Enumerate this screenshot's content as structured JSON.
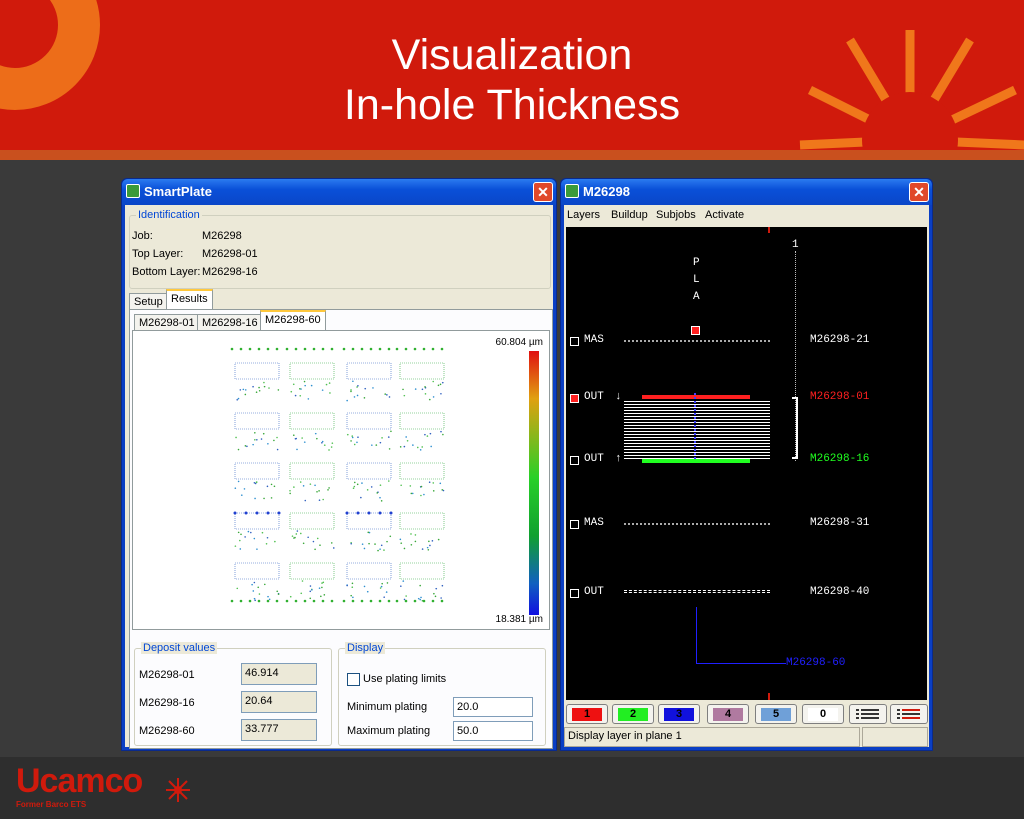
{
  "slide": {
    "title_line1": "Visualization",
    "title_line2": "In-hole Thickness",
    "logo_text": "Ucamco",
    "logo_subtitle": "Former Barco ETS"
  },
  "smartplate": {
    "window_title": "SmartPlate",
    "identification": {
      "legend": "Identification",
      "job_label": "Job:",
      "job_value": "M26298",
      "top_layer_label": "Top Layer:",
      "top_layer_value": "M26298-01",
      "bottom_layer_label": "Bottom Layer:",
      "bottom_layer_value": "M26298-16"
    },
    "tabs": [
      "Setup",
      "Results"
    ],
    "active_tab": "Results",
    "layer_tabs": [
      "M26298-01",
      "M26298-16",
      "M26298-60"
    ],
    "active_layer_tab": "M26298-60",
    "scale_max": "60.804 µm",
    "scale_min": "18.381 µm",
    "deposit": {
      "legend": "Deposit values",
      "rows": [
        {
          "label": "M26298-01",
          "value": "46.914"
        },
        {
          "label": "M26298-16",
          "value": "20.64"
        },
        {
          "label": "M26298-60",
          "value": "33.777"
        }
      ]
    },
    "display": {
      "legend": "Display",
      "use_plating_limits": "Use plating limits",
      "min_label": "Minimum plating",
      "min_value": "20.0",
      "max_label": "Maximum plating",
      "max_value": "50.0"
    }
  },
  "viewer": {
    "window_title": "M26298",
    "menu": [
      "Layers",
      "Buildup",
      "Subjobs",
      "Activate"
    ],
    "pla_letters": [
      "P",
      "L",
      "A"
    ],
    "top_marker": "1",
    "layers": [
      {
        "type": "MAS",
        "name": "M26298-21",
        "color": "#ffffff",
        "box_fill": "#000000",
        "line": "dotted"
      },
      {
        "type": "OUT",
        "name": "M26298-01",
        "color": "#ff2020",
        "box_fill": "#ff2020",
        "line": "copper-top",
        "arrow": "↓"
      },
      {
        "type": "OUT",
        "name": "M26298-16",
        "color": "#20ff20",
        "box_fill": "#000000",
        "line": "copper-bottom",
        "arrow": "↑"
      },
      {
        "type": "MAS",
        "name": "M26298-31",
        "color": "#ffffff",
        "box_fill": "#000000",
        "line": "dotted"
      },
      {
        "type": "OUT",
        "name": "M26298-40",
        "color": "#ffffff",
        "box_fill": "#000000",
        "line": "dashed"
      }
    ],
    "drill_layer": {
      "name": "M26298-60",
      "color": "#2020ff"
    },
    "planes": [
      {
        "label": "1",
        "color": "#ee1111"
      },
      {
        "label": "2",
        "color": "#22ee22"
      },
      {
        "label": "3",
        "color": "#1111dd"
      },
      {
        "label": "4",
        "color": "#b07aa0"
      },
      {
        "label": "5",
        "color": "#6fa0d8"
      },
      {
        "label": "0",
        "color": "#ffffff"
      }
    ],
    "status_text": "Display layer in plane 1"
  }
}
